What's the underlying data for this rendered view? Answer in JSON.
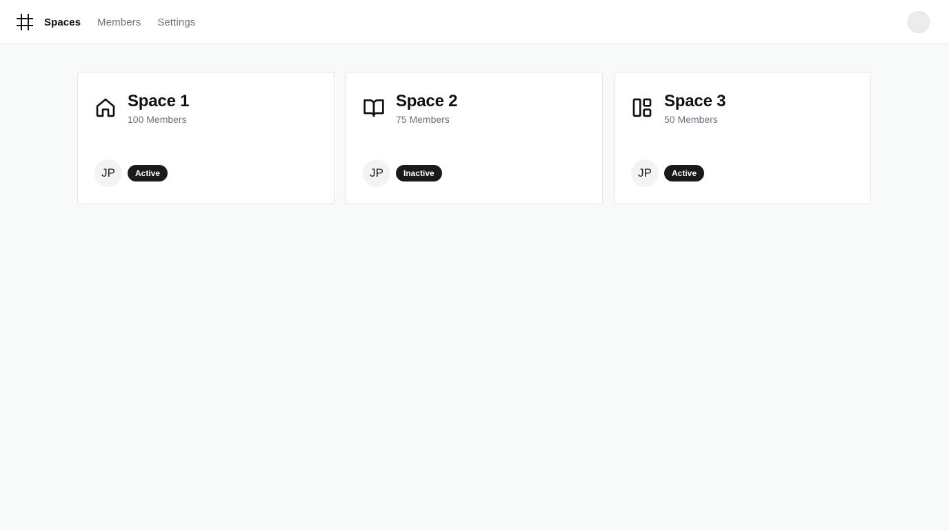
{
  "nav": {
    "logo_icon": "hash-icon",
    "items": [
      {
        "label": "Spaces",
        "active": true
      },
      {
        "label": "Members",
        "active": false
      },
      {
        "label": "Settings",
        "active": false
      }
    ]
  },
  "user": {
    "avatar_icon": "user-avatar"
  },
  "spaces": [
    {
      "title": "Space 1",
      "members": "100 Members",
      "icon": "home-icon",
      "initials": "JP",
      "status": "Active"
    },
    {
      "title": "Space 2",
      "members": "75 Members",
      "icon": "book-open-icon",
      "initials": "JP",
      "status": "Inactive"
    },
    {
      "title": "Space 3",
      "members": "50 Members",
      "icon": "layout-dashboard-icon",
      "initials": "JP",
      "status": "Active"
    }
  ],
  "colors": {
    "background": "#f8f9f9",
    "badge": "#1a1a1a",
    "muted_text": "#6b7280"
  }
}
